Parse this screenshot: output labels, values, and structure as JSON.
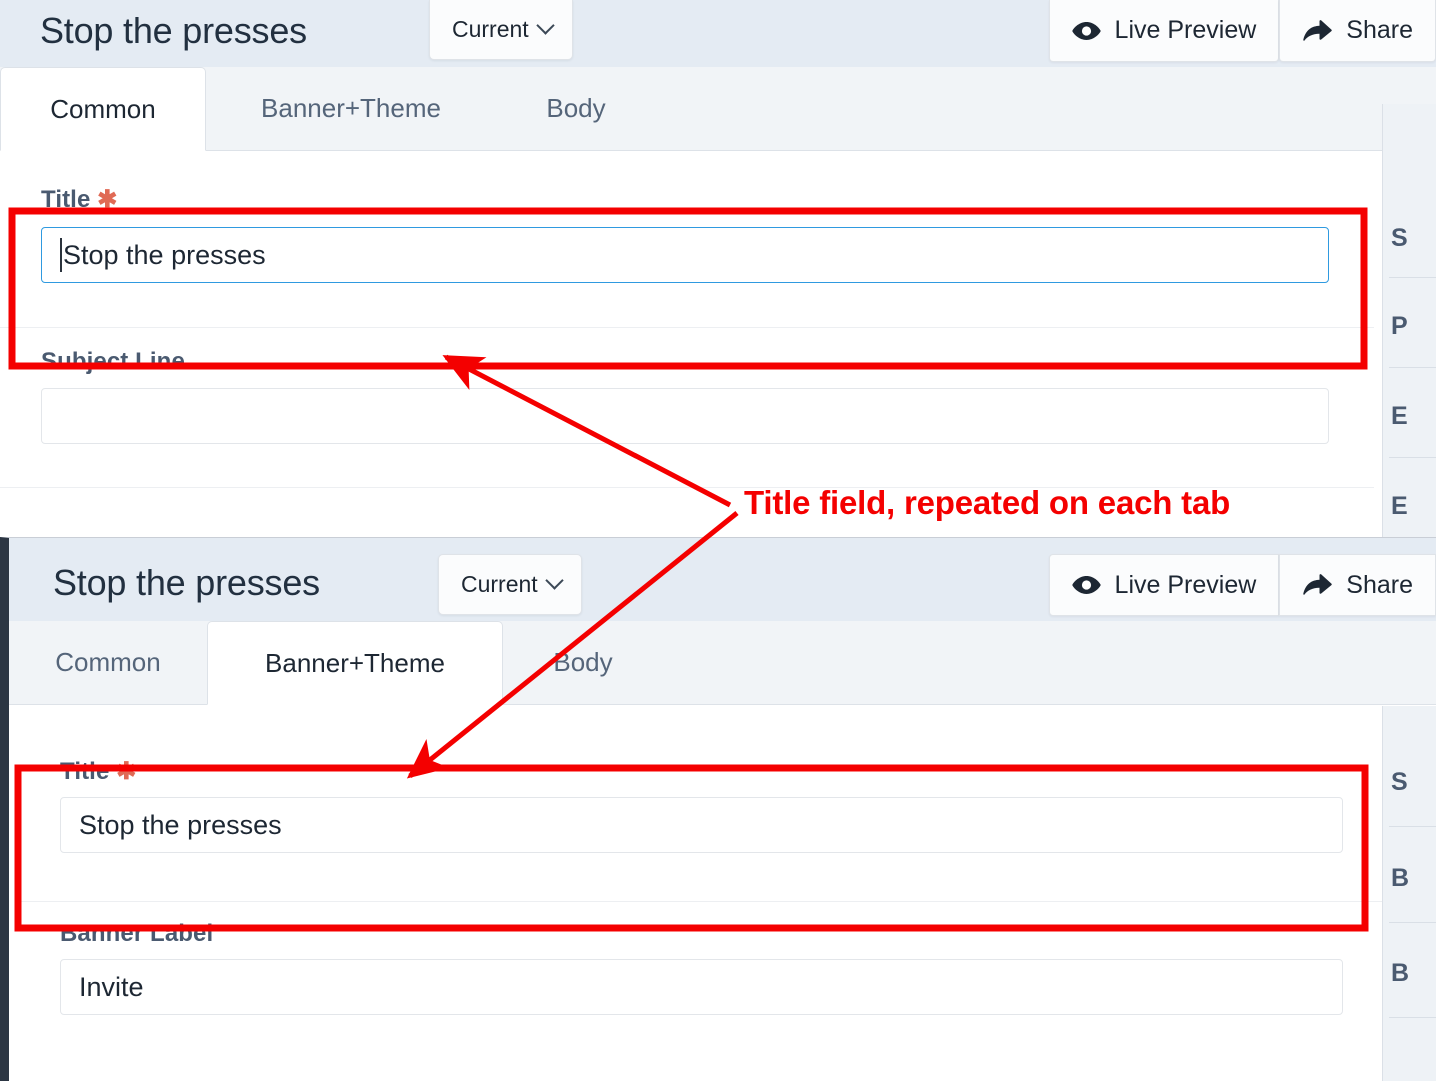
{
  "annotation": {
    "callout_text": "Title field, repeated on each tab",
    "color": "#f40000"
  },
  "panels": [
    {
      "id": "panel-common",
      "header": {
        "doc_title": "Stop the presses",
        "version_chip": "Current",
        "actions": [
          {
            "label": "Live Preview",
            "icon": "eye-icon"
          },
          {
            "label": "Share",
            "icon": "share-arrow-icon"
          }
        ]
      },
      "tabs": [
        {
          "label": "Common",
          "active": true
        },
        {
          "label": "Banner+Theme",
          "active": false
        },
        {
          "label": "Body",
          "active": false
        }
      ],
      "fields": [
        {
          "label": "Title",
          "required": true,
          "value": "Stop the presses",
          "focused": true,
          "highlighted": true
        },
        {
          "label": "Subject Line",
          "required": false,
          "value": "",
          "focused": false,
          "highlighted": false
        }
      ],
      "right_rail": [
        "S",
        "P",
        "E",
        "E"
      ]
    },
    {
      "id": "panel-banner-theme",
      "header": {
        "doc_title": "Stop the presses",
        "version_chip": "Current",
        "actions": [
          {
            "label": "Live Preview",
            "icon": "eye-icon"
          },
          {
            "label": "Share",
            "icon": "share-arrow-icon"
          }
        ]
      },
      "tabs": [
        {
          "label": "Common",
          "active": false
        },
        {
          "label": "Banner+Theme",
          "active": true
        },
        {
          "label": "Body",
          "active": false
        }
      ],
      "fields": [
        {
          "label": "Title",
          "required": true,
          "value": "Stop the presses",
          "focused": false,
          "highlighted": true
        },
        {
          "label": "Banner Label",
          "required": false,
          "value": "Invite",
          "focused": false,
          "highlighted": false
        }
      ],
      "right_rail": [
        "S",
        "B",
        "B"
      ]
    }
  ],
  "colors": {
    "header_bg": "#e4ebf3",
    "tabstrip_bg": "#f1f4f7",
    "label_text": "#4a5a70",
    "focus_border": "#2f9ae0",
    "annotation_red": "#f40000",
    "required_star": "#e06a55"
  }
}
